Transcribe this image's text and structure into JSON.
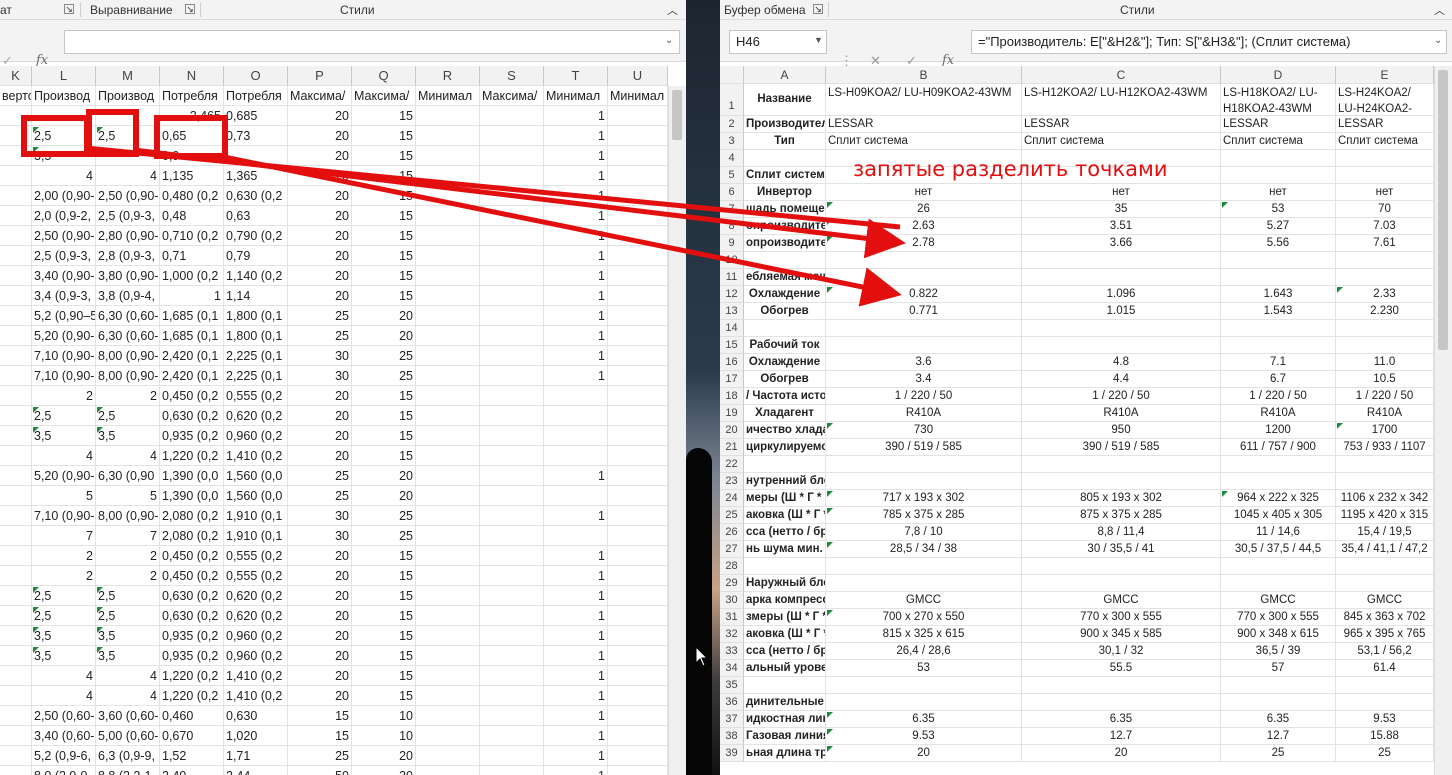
{
  "left": {
    "ribbon": {
      "group1_tail": "ат",
      "group2": "Выравнивание",
      "group3": "Стили"
    },
    "formula": {
      "value": ""
    },
    "columns": [
      "K",
      "L",
      "M",
      "N",
      "O",
      "P",
      "Q",
      "R",
      "S",
      "T",
      "U"
    ],
    "captions": [
      "вертор",
      "Производ",
      "Производ",
      "Потребля",
      "Потребля",
      "Максима/",
      "Максима/",
      "Минимал",
      "Максима/",
      "Минимал",
      "Минимал"
    ],
    "rows": [
      [
        "",
        "",
        "",
        "",
        "2,465|0,685",
        "20",
        "15",
        "",
        "",
        "1",
        ""
      ],
      [
        "",
        "2,5",
        "2,5",
        "0,65",
        "0,73",
        "20",
        "15",
        "",
        "",
        "1",
        ""
      ],
      [
        "",
        "3,5",
        "",
        "0,9",
        "",
        "20",
        "15",
        "",
        "",
        "1",
        ""
      ],
      [
        "",
        "4",
        "4",
        "1,135",
        "1,365",
        "20",
        "15",
        "",
        "",
        "1",
        ""
      ],
      [
        "",
        "2,00 (0,90-",
        "2,50 (0,90-",
        "0,480 (0,2",
        "0,630 (0,2",
        "20",
        "15",
        "",
        "",
        "1",
        ""
      ],
      [
        "",
        "2,0 (0,9-2,",
        "2,5 (0,9-3,",
        "0,48",
        "0,63",
        "20",
        "15",
        "",
        "",
        "1",
        ""
      ],
      [
        "",
        "2,50 (0,90-",
        "2,80 (0,90-",
        "0,710 (0,2",
        "0,790 (0,2",
        "20",
        "15",
        "",
        "",
        "1",
        ""
      ],
      [
        "",
        "2,5 (0,9-3,",
        "2,8 (0,9-3,",
        "0,71",
        "0,79",
        "20",
        "15",
        "",
        "",
        "1",
        ""
      ],
      [
        "",
        "3,40 (0,90-",
        "3,80 (0,90-",
        "1,000 (0,2",
        "1,140 (0,2",
        "20",
        "15",
        "",
        "",
        "1",
        ""
      ],
      [
        "",
        "3,4 (0,9-3,",
        "3,8 (0,9-4,",
        "1",
        "1,14",
        "20",
        "15",
        "",
        "",
        "1",
        ""
      ],
      [
        "",
        "5,2 (0,90–5",
        "6,30 (0,60-",
        "1,685 (0,1",
        "1,800 (0,1",
        "25",
        "20",
        "",
        "",
        "1",
        ""
      ],
      [
        "",
        "5,20 (0,90-",
        "6,30 (0,60-",
        "1,685 (0,1",
        "1,800 (0,1",
        "25",
        "20",
        "",
        "",
        "1",
        ""
      ],
      [
        "",
        "7,10 (0,90-",
        "8,00 (0,90-",
        "2,420 (0,1",
        "2,225 (0,1",
        "30",
        "25",
        "",
        "",
        "1",
        ""
      ],
      [
        "",
        "7,10 (0,90-",
        "8,00 (0,90-",
        "2,420 (0,1",
        "2,225 (0,1",
        "30",
        "25",
        "",
        "",
        "1",
        ""
      ],
      [
        "",
        "2",
        "2",
        "0,450 (0,2",
        "0,555 (0,2",
        "20",
        "15",
        "",
        "",
        "",
        ""
      ],
      [
        "",
        "2,5",
        "2,5",
        "0,630 (0,2",
        "0,620 (0,2",
        "20",
        "15",
        "",
        "",
        "",
        ""
      ],
      [
        "",
        "3,5",
        "3,5",
        "0,935 (0,2",
        "0,960 (0,2",
        "20",
        "15",
        "",
        "",
        "",
        ""
      ],
      [
        "",
        "4",
        "4",
        "1,220 (0,2",
        "1,410 (0,2",
        "20",
        "15",
        "",
        "",
        "",
        ""
      ],
      [
        "",
        "5,20 (0,90-",
        "6,30  (0,90",
        "1,390 (0,0",
        "1,560 (0,0",
        "25",
        "20",
        "",
        "",
        "1",
        ""
      ],
      [
        "",
        "5",
        "5",
        "1,390 (0,0",
        "1,560 (0,0",
        "25",
        "20",
        "",
        "",
        "",
        ""
      ],
      [
        "",
        "7,10 (0,90-",
        "8,00 (0,90-",
        "2,080 (0,2",
        "1,910 (0,1",
        "30",
        "25",
        "",
        "",
        "1",
        ""
      ],
      [
        "",
        "7",
        "7",
        "2,080 (0,2",
        "1,910 (0,1",
        "30",
        "25",
        "",
        "",
        "",
        ""
      ],
      [
        "",
        "2",
        "2",
        "0,450 (0,2",
        "0,555 (0,2",
        "20",
        "15",
        "",
        "",
        "1",
        ""
      ],
      [
        "",
        "2",
        "2",
        "0,450 (0,2",
        "0,555 (0,2",
        "20",
        "15",
        "",
        "",
        "1",
        ""
      ],
      [
        "",
        "2,5",
        "2,5",
        "0,630 (0,2",
        "0,620 (0,2",
        "20",
        "15",
        "",
        "",
        "1",
        ""
      ],
      [
        "",
        "2,5",
        "2,5",
        "0,630 (0,2",
        "0,620 (0,2",
        "20",
        "15",
        "",
        "",
        "1",
        ""
      ],
      [
        "",
        "3,5",
        "3,5",
        "0,935 (0,2",
        "0,960 (0,2",
        "20",
        "15",
        "",
        "",
        "1",
        ""
      ],
      [
        "",
        "3,5",
        "3,5",
        "0,935 (0,2",
        "0,960 (0,2",
        "20",
        "15",
        "",
        "",
        "1",
        ""
      ],
      [
        "",
        "4",
        "4",
        "1,220 (0,2",
        "1,410 (0,2",
        "20",
        "15",
        "",
        "",
        "1",
        ""
      ],
      [
        "",
        "4",
        "4",
        "1,220 (0,2",
        "1,410 (0,2",
        "20",
        "15",
        "",
        "",
        "1",
        ""
      ],
      [
        "",
        "2,50 (0,60-",
        "3,60 (0,60-",
        "0,460",
        "0,630",
        "15",
        "10",
        "",
        "",
        "1",
        ""
      ],
      [
        "",
        "3,40 (0,60-",
        "5,00 (0,60-",
        "0,670",
        "1,020",
        "15",
        "10",
        "",
        "",
        "1",
        ""
      ],
      [
        "",
        "5,2 (0,9-6,",
        "6,3 (0,9-9,",
        "1,52",
        "1,71",
        "25",
        "20",
        "",
        "",
        "1",
        ""
      ],
      [
        "",
        "8,0 (2,9-9",
        "8,8 (2,2-1",
        "2,49",
        "2,44",
        "50",
        "30",
        "",
        "",
        "1",
        ""
      ]
    ]
  },
  "right": {
    "ribbon": {
      "group1": "Буфер обмена",
      "group2": "Стили"
    },
    "name_box": "H46",
    "formula": "=\"Производитель: E[\"&H2&\"]; Тип: S[\"&H3&\"]; (Сплит система)",
    "columns": [
      "A",
      "B",
      "C",
      "D",
      "E"
    ],
    "row_numbers": [
      "1",
      "2",
      "3",
      "4",
      "5",
      "6",
      "7",
      "8",
      "9",
      "10",
      "11",
      "12",
      "13",
      "14",
      "15",
      "16",
      "17",
      "18",
      "19",
      "20",
      "21",
      "22",
      "23",
      "24",
      "25",
      "26",
      "27",
      "28",
      "29",
      "30",
      "31",
      "32",
      "33",
      "34",
      "35",
      "36",
      "37",
      "38",
      "39"
    ],
    "rows": [
      [
        "Название",
        "LS-H09KOA2/ LU-H09KOA2-43WM",
        "LS-H12KOA2/ LU-H12KOA2-43WM",
        "LS-H18KOA2/ LU-H18KOA2-43WM",
        "LS-H24KOA2/ LU-H24KOA2-43WM"
      ],
      [
        "Производитель",
        "LESSAR",
        "LESSAR",
        "LESSAR",
        "LESSAR"
      ],
      [
        "Тип",
        "Сплит система",
        "Сплит система",
        "Сплит система",
        "Сплит система"
      ],
      [
        "",
        "",
        "",
        "",
        ""
      ],
      [
        "Сплит система",
        "",
        "",
        "",
        ""
      ],
      [
        "Инвертор",
        "нет",
        "нет",
        "нет",
        "нет"
      ],
      [
        "щадь помещен",
        "26",
        "35",
        "53",
        "70"
      ],
      [
        "опроизводител",
        "2.63",
        "3.51",
        "5.27",
        "7.03"
      ],
      [
        "опроизводител",
        "2.78",
        "3.66",
        "5.56",
        "7.61"
      ],
      [
        "",
        "",
        "",
        "",
        ""
      ],
      [
        "ебляемая мощн",
        "",
        "",
        "",
        ""
      ],
      [
        "Охлаждение",
        "0.822",
        "1.096",
        "1.643",
        "2.33"
      ],
      [
        "Обогрев",
        "0.771",
        "1.015",
        "1.543",
        "2.230"
      ],
      [
        "",
        "",
        "",
        "",
        ""
      ],
      [
        "Рабочий ток",
        "",
        "",
        "",
        ""
      ],
      [
        "Охлаждение",
        "3.6",
        "4.8",
        "7.1",
        "11.0"
      ],
      [
        "Обогрев",
        "3.4",
        "4.4",
        "6.7",
        "10.5"
      ],
      [
        "/ Частота источ",
        "1 / 220 / 50",
        "1 / 220 / 50",
        "1 / 220 / 50",
        "1 / 220 / 50"
      ],
      [
        "Хладагент",
        "R410A",
        "R410A",
        "R410A",
        "R410A"
      ],
      [
        "ичество хладаге",
        "730",
        "950",
        "1200",
        "1700"
      ],
      [
        "циркулируемог",
        "390 / 519 / 585",
        "390 / 519 / 585",
        "611 / 757 / 900",
        "753 / 933 / 1107"
      ],
      [
        "",
        "",
        "",
        "",
        ""
      ],
      [
        "нутренний блок",
        "",
        "",
        "",
        ""
      ],
      [
        "меры (Ш * Г *",
        "717 x 193 x 302",
        "805 x 193 x 302",
        "964 x 222 x 325",
        "1106 x 232 x 342"
      ],
      [
        "аковка (Ш * Г *",
        "785 x 375 x 285",
        "875 x 375 x 285",
        "1045 x 405 x 305",
        "1195 x 420 x 315"
      ],
      [
        "сса (нетто / брут",
        "7,8 / 10",
        "8,8 / 11,4",
        "11 / 14,6",
        "15,4 / 19,5"
      ],
      [
        "нь шума мин. /",
        "28,5 / 34 / 38",
        "30 / 35,5 / 41",
        "30,5 / 37,5 / 44,5",
        "35,4 / 41,1 / 47,2"
      ],
      [
        "",
        "",
        "",
        "",
        ""
      ],
      [
        "Наружный блок",
        "",
        "",
        "",
        ""
      ],
      [
        "арка компрессор",
        "GMCC",
        "GMCC",
        "GMCC",
        "GMCC"
      ],
      [
        "змеры (Ш * Г *",
        "700 x 270 x 550",
        "770 x 300 x 555",
        "770 x 300 x 555",
        "845 x 363 x 702"
      ],
      [
        "аковка (Ш * Г *",
        "815 x 325 x 615",
        "900 x 345 x 585",
        "900 x 348 x 615",
        "965 x 395 x 765"
      ],
      [
        "сса (нетто / брут",
        "26,4 / 28,6",
        "30,1 / 32",
        "36,5 / 39",
        "53,1 / 56,2"
      ],
      [
        "альный уровен",
        "53",
        "55.5",
        "57",
        "61.4"
      ],
      [
        "",
        "",
        "",
        "",
        ""
      ],
      [
        "динительные трубы",
        "",
        "",
        "",
        ""
      ],
      [
        "идкостная лини",
        "6.35",
        "6.35",
        "6.35",
        "9.53"
      ],
      [
        "Газовая линия",
        "9.53",
        "12.7",
        "12.7",
        "15.88"
      ],
      [
        "ьная длина тру",
        "20",
        "20",
        "25",
        "25"
      ]
    ]
  },
  "annotation": {
    "text": "запятые разделить точками",
    "color": "#e30f0f"
  }
}
